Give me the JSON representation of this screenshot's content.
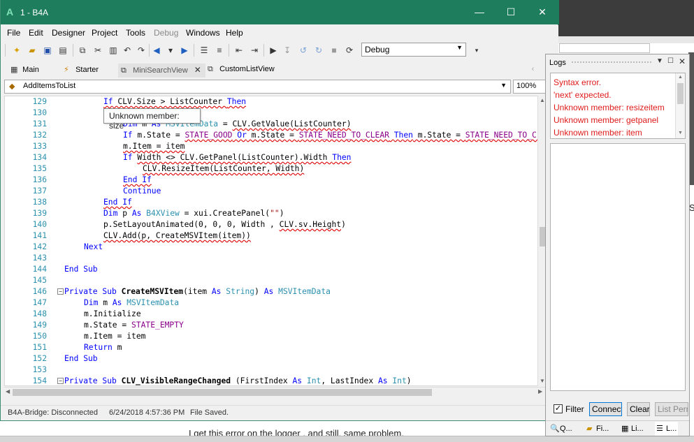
{
  "window": {
    "title": "1 - B4A",
    "app_icon": "A"
  },
  "menu": [
    "File",
    "Edit",
    "Designer",
    "Project",
    "Tools",
    "Debug",
    "Windows",
    "Help"
  ],
  "toolbar": {
    "build_config": "Debug"
  },
  "tabs": [
    {
      "label": "Main",
      "icon": "module-icon"
    },
    {
      "label": "Starter",
      "icon": "service-icon"
    },
    {
      "label": "MiniSearchView",
      "icon": "class-icon",
      "active": true
    },
    {
      "label": "CustomListView",
      "icon": "class-icon"
    }
  ],
  "editor": {
    "sub_selector": "AddItemsToList",
    "zoom": "100%",
    "tooltip": "Unknown member: size",
    "lines": [
      {
        "n": "129",
        "html": "<span class=\"err\"><span class=\"kw\">If</span> CLV.Size &gt; ListCounter <span class=\"kw\">Then</span></span>"
      },
      {
        "n": "130",
        "html": ""
      },
      {
        "n": "131",
        "html": "<span class=\"kw\">Dim</span> m <span class=\"kw\">As</span> <span class=\"ty\">MSVItemData</span> = <span class=\"err\">CLV.GetValue(ListCounter)</span>"
      },
      {
        "n": "132",
        "html": "<span class=\"kw\">If</span> m.State = <span class=\"err\"><span class=\"cst\">STATE_GOOD</span> <span class=\"kw\">Or</span> m.State = <span class=\"cst\">STATE_NEED_TO_CLEAR</span> <span class=\"kw\">Then</span> m.State = <span class=\"cst\">STATE_NEED_TO_CLEAR</span></span>"
      },
      {
        "n": "133",
        "html": "<span class=\"err\">m.Item = item</span>"
      },
      {
        "n": "134",
        "html": "<span class=\"kw\">If</span> <span class=\"err\">Width &lt;&gt; CLV.GetPanel(ListCounter).Width <span class=\"kw\">Then</span></span>"
      },
      {
        "n": "135",
        "html": "<span class=\"err\">CLV.ResizeItem(ListCounter, Width)</span>"
      },
      {
        "n": "136",
        "html": "<span class=\"kw err\">End If</span>"
      },
      {
        "n": "137",
        "html": "<span class=\"kw\">Continue</span>"
      },
      {
        "n": "138",
        "html": "<span class=\"kw err\">End If</span>"
      },
      {
        "n": "139",
        "html": "<span class=\"kw\">Dim</span> p <span class=\"kw\">As</span> <span class=\"ty\">B4XView</span> = xui.CreatePanel(<span class=\"str\">\"\"</span>)"
      },
      {
        "n": "140",
        "html": "p.SetLayoutAnimated(0, 0, 0, Width , <span class=\"err\">CLV.sv.Height</span>)"
      },
      {
        "n": "141",
        "html": "<span class=\"err\">CLV.Add(p, CreateMSVItem(item))</span>"
      },
      {
        "n": "142",
        "html": "<span class=\"kw\">Next</span>"
      },
      {
        "n": "143",
        "html": ""
      },
      {
        "n": "144",
        "html": "<span class=\"kw\">End Sub</span>"
      },
      {
        "n": "145",
        "html": ""
      },
      {
        "n": "146",
        "html": "<span class=\"kw\">Private Sub</span> <span class=\"fn\">CreateMSVItem</span>(item <span class=\"kw\">As</span> <span class=\"ty\">String</span>) <span class=\"kw\">As</span> <span class=\"ty\">MSVItemData</span>",
        "fold": true
      },
      {
        "n": "147",
        "html": "<span class=\"kw\">Dim</span> m <span class=\"kw\">As</span> <span class=\"ty\">MSVItemData</span>"
      },
      {
        "n": "148",
        "html": "m.Initialize"
      },
      {
        "n": "149",
        "html": "m.State = <span class=\"cst\">STATE_EMPTY</span>"
      },
      {
        "n": "150",
        "html": "m.Item = item"
      },
      {
        "n": "151",
        "html": "<span class=\"kw\">Return</span> m"
      },
      {
        "n": "152",
        "html": "<span class=\"kw\">End Sub</span>"
      },
      {
        "n": "153",
        "html": ""
      },
      {
        "n": "154",
        "html": "<span class=\"kw\">Private Sub</span> <span class=\"fn\">CLV_VisibleRangeChanged</span> (FirstIndex <span class=\"kw\">As</span> <span class=\"ty\">Int</span>, LastIndex <span class=\"kw\">As</span> <span class=\"ty\">Int</span>)",
        "fold": true
      }
    ]
  },
  "status": {
    "bridge": "B4A-Bridge: Disconnected",
    "timestamp": "6/24/2018 4:57:36 PM",
    "message": "File Saved."
  },
  "logs": {
    "title": "Logs",
    "entries": [
      "Syntax error.",
      "'next' expected.",
      "Unknown member: resizeitem",
      "Unknown member: getpanel",
      "Unknown member: item"
    ],
    "filter_label": "Filter",
    "connect_label": "Connect",
    "clear_label": "Clear",
    "list_label": "List Perm",
    "bottom_tabs": [
      "Q...",
      "Fi...",
      "Li...",
      "L..."
    ],
    "error_color": "#e01b1b"
  },
  "background": {
    "text": "I get this error on the logger , and still, same problem.",
    "edge_letter": "S"
  }
}
